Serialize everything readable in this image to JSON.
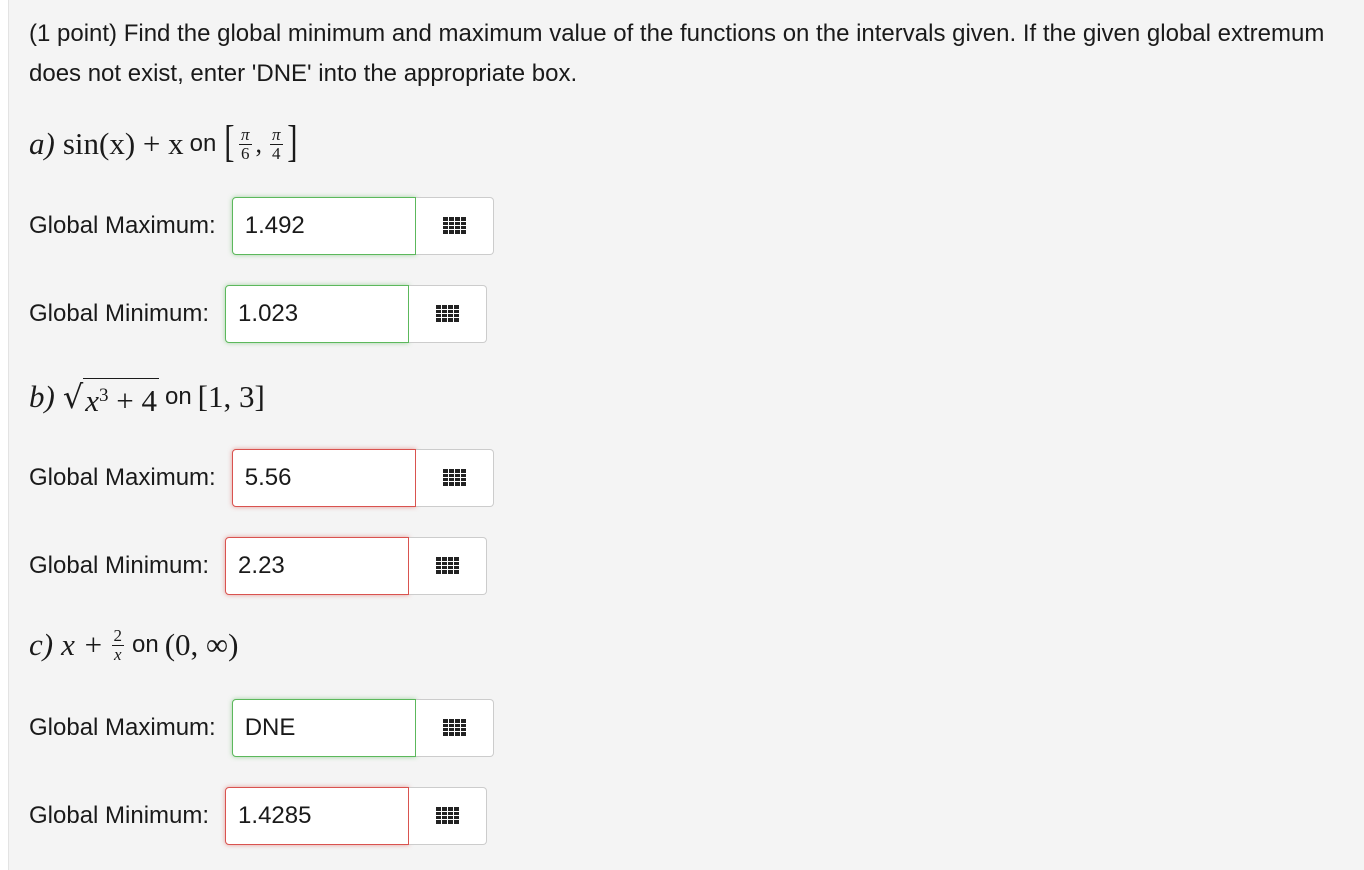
{
  "instructions": "(1 point) Find the global minimum and maximum value of the functions on the intervals given. If the given global extremum does not exist, enter 'DNE' into the appropriate box.",
  "on_word": "on",
  "parts": [
    {
      "letter": "a)",
      "function_text": "sin(x) + x",
      "interval": {
        "left": "[",
        "a_num": "π",
        "a_den": "6",
        "b_num": "π",
        "b_den": "4",
        "right": "]"
      },
      "answers": [
        {
          "label": "Global Maximum:",
          "value": "1.492",
          "status": "correct",
          "button_icon": "grid-icon"
        },
        {
          "label": "Global Minimum:",
          "value": "1.023",
          "status": "correct",
          "button_icon": "grid-icon"
        }
      ]
    },
    {
      "letter": "b)",
      "function_text": "√(x³ + 4)",
      "radicand_base": "x",
      "radicand_exp": "3",
      "radicand_rest": " + 4",
      "interval_text": "[1, 3]",
      "answers": [
        {
          "label": "Global Maximum:",
          "value": "5.56",
          "status": "incorrect",
          "button_icon": "grid-icon"
        },
        {
          "label": "Global Minimum:",
          "value": "2.23",
          "status": "incorrect",
          "button_icon": "grid-icon"
        }
      ]
    },
    {
      "letter": "c)",
      "function_text": "x + 2/x",
      "term_x": "x +",
      "frac_num": "2",
      "frac_den": "x",
      "interval_text": "(0, ∞)",
      "answers": [
        {
          "label": "Global Maximum:",
          "value": "DNE",
          "status": "correct",
          "button_icon": "grid-icon"
        },
        {
          "label": "Global Minimum:",
          "value": "1.4285",
          "status": "incorrect",
          "button_icon": "grid-icon"
        }
      ]
    }
  ],
  "colors": {
    "panel_bg": "#f4f4f4",
    "correct_border": "#5cb85c",
    "incorrect_border": "#d9534f"
  }
}
